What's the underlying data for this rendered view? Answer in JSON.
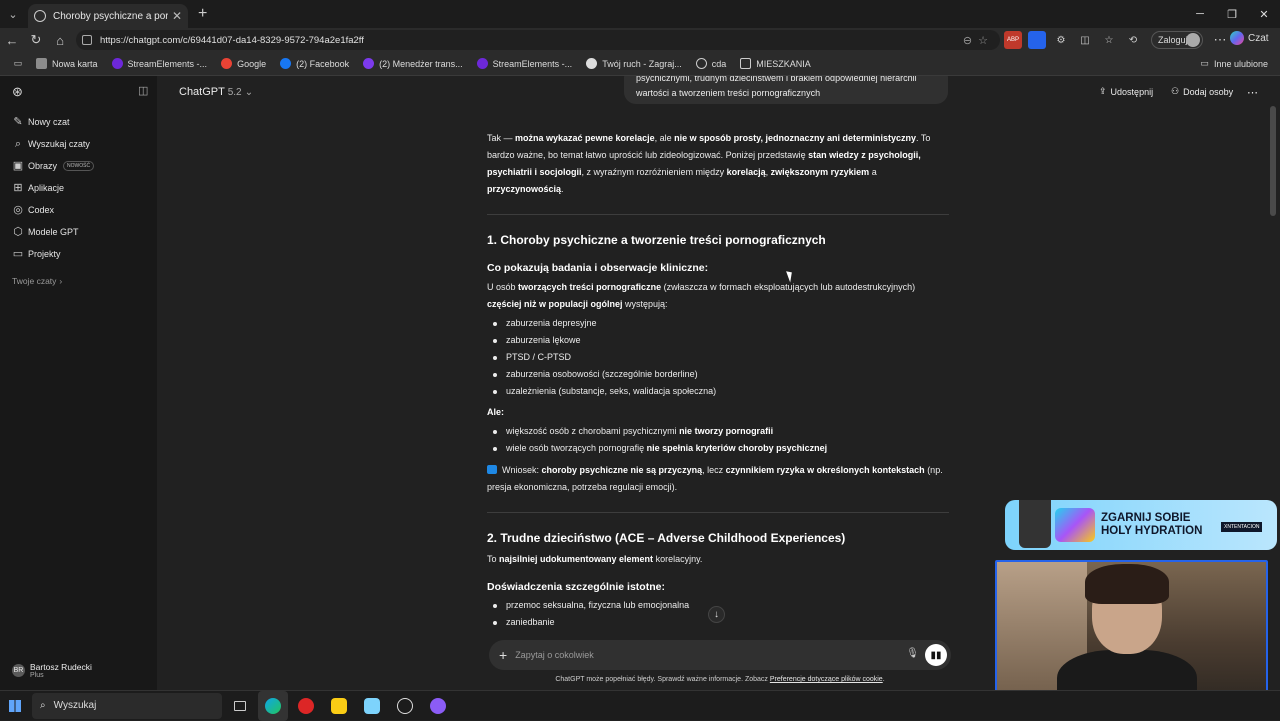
{
  "browser": {
    "tab_title": "Choroby psychiczne a pornografia",
    "url": "https://chatgpt.com/c/69441d07-da14-8329-9572-794a2e1fa2ff",
    "login_label": "Zaloguj",
    "copilot_label": "Czat",
    "bookmarks": [
      "Nowa karta",
      "StreamElements -...",
      "Google",
      "(2) Facebook",
      "(2) Menedżer trans...",
      "StreamElements -...",
      "Twój ruch - Zagraj...",
      "cda",
      "MIESZKANIA"
    ],
    "other_bookmarks": "Inne ulubione"
  },
  "sidebar": {
    "items": [
      {
        "label": "Nowy czat",
        "icon": "edit-icon"
      },
      {
        "label": "Wyszukaj czaty",
        "icon": "search-icon"
      },
      {
        "label": "Obrazy",
        "icon": "image-icon",
        "badge": "NOWOŚĆ"
      },
      {
        "label": "Aplikacje",
        "icon": "apps-icon"
      },
      {
        "label": "Codex",
        "icon": "codex-icon"
      },
      {
        "label": "Modele GPT",
        "icon": "gpt-icon"
      },
      {
        "label": "Projekty",
        "icon": "folder-icon"
      }
    ],
    "section_label": "Twoje czaty",
    "user_name": "Bartosz Rudecki",
    "user_plan": "Plus",
    "user_initials": "BR"
  },
  "header": {
    "model": "ChatGPT",
    "model_version": "5.2",
    "share_label": "Udostępnij",
    "add_people_label": "Dodaj osoby"
  },
  "user_bubble": "psychicznymi, trudnym dzieciństwem i brakiem odpowiedniej hierarchii wartości a tworzeniem treści pornograficznych",
  "answer": {
    "intro": {
      "a": "Tak — ",
      "b": "można wykazać pewne korelacje",
      "c": ", ale ",
      "d": "nie w sposób prosty, jednoznaczny ani deterministyczny",
      "e": ". To bardzo ważne, bo temat łatwo uprościć lub zideologizować. Poniżej przedstawię ",
      "f": "stan wiedzy z psychologii, psychiatrii i socjologii",
      "g": ", z wyraźnym rozróżnieniem między ",
      "h": "korelacją",
      "i": ", ",
      "j": "zwiększonym ryzykiem",
      "k": " a ",
      "l": "przyczynowością",
      "m": "."
    },
    "section1_title": "1. Choroby psychiczne a tworzenie treści pornograficznych",
    "section1_sub": "Co pokazują badania i obserwacje kliniczne:",
    "s1p": {
      "a": "U osób ",
      "b": "tworzących treści pornograficzne",
      "c": " (zwłaszcza w formach eksploatujących lub autodestrukcyjnych) ",
      "d": "częściej niż w populacji ogólnej",
      "e": " występują:"
    },
    "s1_list": [
      "zaburzenia depresyjne",
      "zaburzenia lękowe",
      "PTSD / C-PTSD",
      "zaburzenia osobowości (szczególnie borderline)",
      "uzależnienia (substancje, seks, walidacja społeczna)"
    ],
    "ale": "Ale:",
    "ale_list": [
      {
        "a": "większość osób z chorobami psychicznymi ",
        "b": "nie tworzy pornografii"
      },
      {
        "a": "wiele osób tworzących pornografię ",
        "b": "nie spełnia kryteriów choroby psychicznej"
      }
    ],
    "wniosek": {
      "a": "Wniosek: ",
      "b": "choroby psychiczne nie są przyczyną",
      "c": ", lecz ",
      "d": "czynnikiem ryzyka w określonych kontekstach",
      "e": " (np. presja ekonomiczna, potrzeba regulacji emocji)."
    },
    "section2_title": "2. Trudne dzieciństwo (ACE – Adverse Childhood Experiences)",
    "s2p": {
      "a": "To ",
      "b": "najsilniej udokumentowany element",
      "c": " korelacyjny."
    },
    "section2_sub": "Doświadczenia szczególnie istotne:",
    "s2_list": [
      "przemoc seksualna, fizyczna lub emocjonalna",
      "zaniedbanie"
    ]
  },
  "composer": {
    "placeholder": "Zapytaj o cokolwiek",
    "disclaimer": "ChatGPT może popełniać błędy. Sprawdź ważne informacje. Zobacz ",
    "disclaimer_link": "Preferencje dotyczące plików cookie",
    "disclaimer_end": "."
  },
  "ad": {
    "headline": "ZGARNIJ SOBIE HOLY HYDRATION",
    "sub": "XNTENTACION"
  },
  "taskbar": {
    "search_label": "Wyszukaj"
  }
}
